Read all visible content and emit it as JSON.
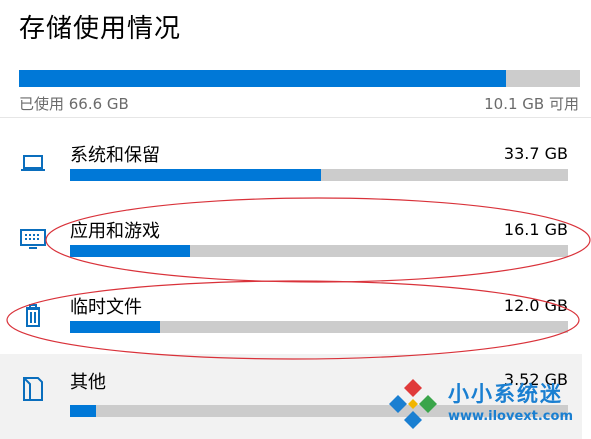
{
  "page": {
    "title": "存储使用情况"
  },
  "storage": {
    "used_fraction": 0.868,
    "used_label": "已使用 66.6 GB",
    "free_label": "10.1 GB 可用"
  },
  "categories": [
    {
      "label": "系统和保留",
      "size": "33.7 GB",
      "fraction": 0.505,
      "icon": "laptop-icon"
    },
    {
      "label": "应用和游戏",
      "size": "16.1 GB",
      "fraction": 0.241,
      "icon": "keyboard-icon"
    },
    {
      "label": "临时文件",
      "size": "12.0 GB",
      "fraction": 0.181,
      "icon": "trash-icon"
    },
    {
      "label": "其他",
      "size": "3.52 GB",
      "fraction": 0.053,
      "icon": "folder-icon"
    }
  ],
  "watermark": {
    "title": "小小系统迷",
    "url": "www.ilovext.com"
  },
  "colors": {
    "accent": "#0078d7",
    "track": "#cccccc",
    "annotation": "#d9323a",
    "watermark": "#1a7fd1"
  }
}
